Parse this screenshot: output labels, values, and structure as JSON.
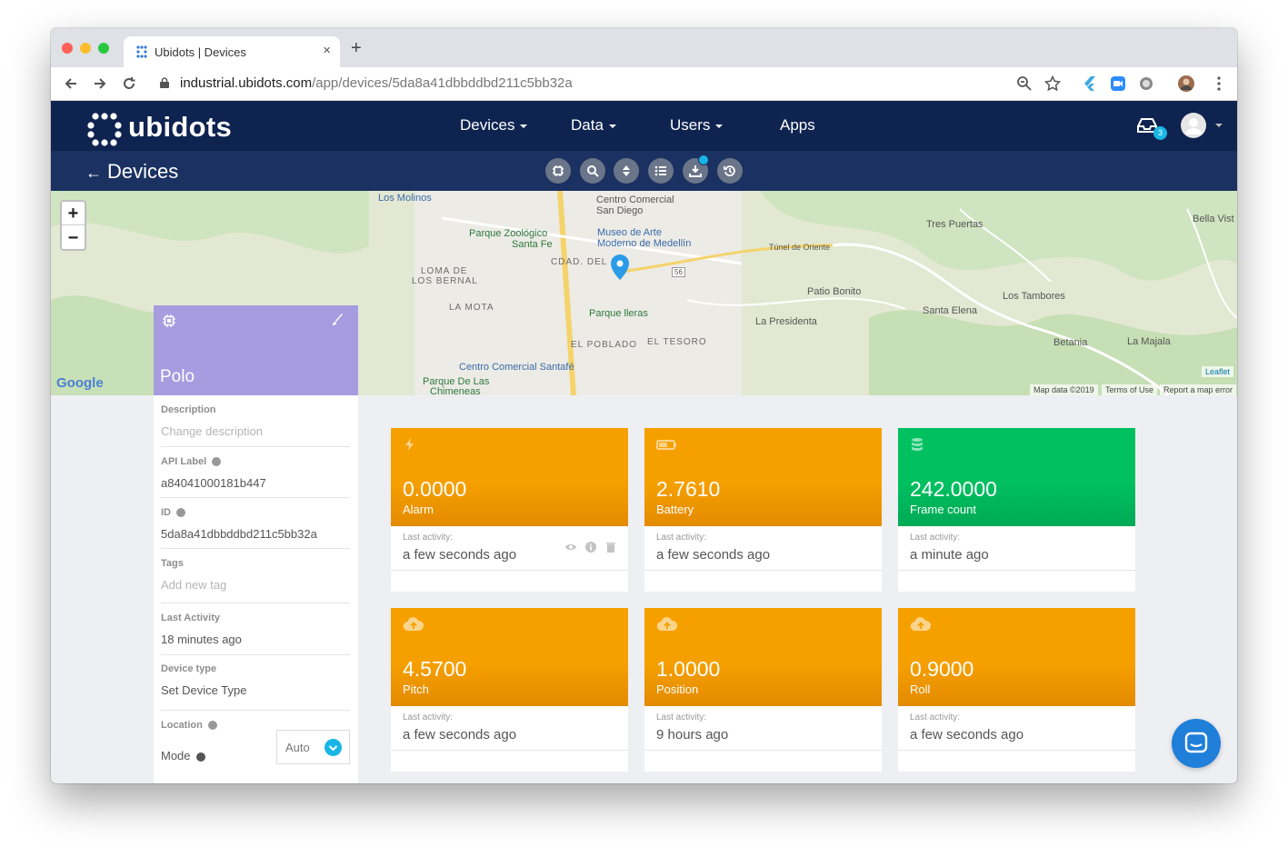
{
  "browser": {
    "tab_title": "Ubidots | Devices",
    "tab_close": "×",
    "new_tab": "+",
    "url_host": "industrial.ubidots.com",
    "url_path": "/app/devices/5da8a41dbbddbd211c5bb32a"
  },
  "nav": {
    "logo": "ubidots",
    "items": [
      "Devices",
      "Data",
      "Users",
      "Apps"
    ],
    "notification_count": "3"
  },
  "subnav": {
    "title": "Devices",
    "back_arrow": "←"
  },
  "map": {
    "labels": [
      "Los Molinos",
      "Centro Comercial",
      "San Diego",
      "Parque Zoológico",
      "Santa Fe",
      "Museo de Arte",
      "Moderno de Medellín",
      "CDAD. DEL",
      "LOMA DE",
      "LOS BERNAL",
      "LA MOTA",
      "Parque lleras",
      "EL POBLADO",
      "EL TESORO",
      "Centro Comercial Santafé",
      "Parque De Las",
      "Chimeneas",
      "Tres Puertas",
      "Bella Vist",
      "Túnel de Oriente",
      "Patio Bonito",
      "Los Tambores",
      "La Presidenta",
      "Santa Elena",
      "Betania",
      "La Majala",
      "56"
    ],
    "zoom_in": "+",
    "zoom_out": "−",
    "google": "Google",
    "leaflet": "Leaflet",
    "map_data": "Map data ©2019",
    "terms": "Terms of Use",
    "report": "Report a map error"
  },
  "device": {
    "name": "Polo",
    "fields": [
      {
        "label": "Description",
        "value": "Change description",
        "placeholder": true,
        "info": false
      },
      {
        "label": "API Label",
        "value": "a84041000181b447",
        "placeholder": false,
        "info": true
      },
      {
        "label": "ID",
        "value": "5da8a41dbbddbd211c5bb32a",
        "placeholder": false,
        "info": true
      },
      {
        "label": "Tags",
        "value": "Add new tag",
        "placeholder": true,
        "info": false
      },
      {
        "label": "Last Activity",
        "value": "18 minutes ago",
        "placeholder": false,
        "info": false
      },
      {
        "label": "Device type",
        "value": "Set Device Type",
        "placeholder": false,
        "info": false
      }
    ],
    "location_label": "Location",
    "mode_label": "Mode",
    "mode_value": "Auto"
  },
  "variables": {
    "last_activity_label": "Last activity:",
    "items": [
      {
        "value": "0.0000",
        "name": "Alarm",
        "time": "a few seconds ago",
        "color": "#f6a000",
        "icon": "bolt-icon"
      },
      {
        "value": "2.7610",
        "name": "Battery",
        "time": "a few seconds ago",
        "color": "#f6a000",
        "icon": "battery-icon"
      },
      {
        "value": "242.0000",
        "name": "Frame count",
        "time": "a minute ago",
        "color": "#00c060",
        "icon": "database-icon"
      },
      {
        "value": "4.5700",
        "name": "Pitch",
        "time": "a few seconds ago",
        "color": "#f6a000",
        "icon": "cloud-upload-icon"
      },
      {
        "value": "1.0000",
        "name": "Position",
        "time": "9 hours ago",
        "color": "#f6a000",
        "icon": "cloud-upload-icon"
      },
      {
        "value": "0.9000",
        "name": "Roll",
        "time": "a few seconds ago",
        "color": "#f6a000",
        "icon": "cloud-upload-icon"
      }
    ]
  },
  "colors": {
    "nav_bg": "#0f2350",
    "subnav_bg": "#1a3161",
    "device_card": "#a79ce0",
    "accent": "#18b6e4"
  }
}
